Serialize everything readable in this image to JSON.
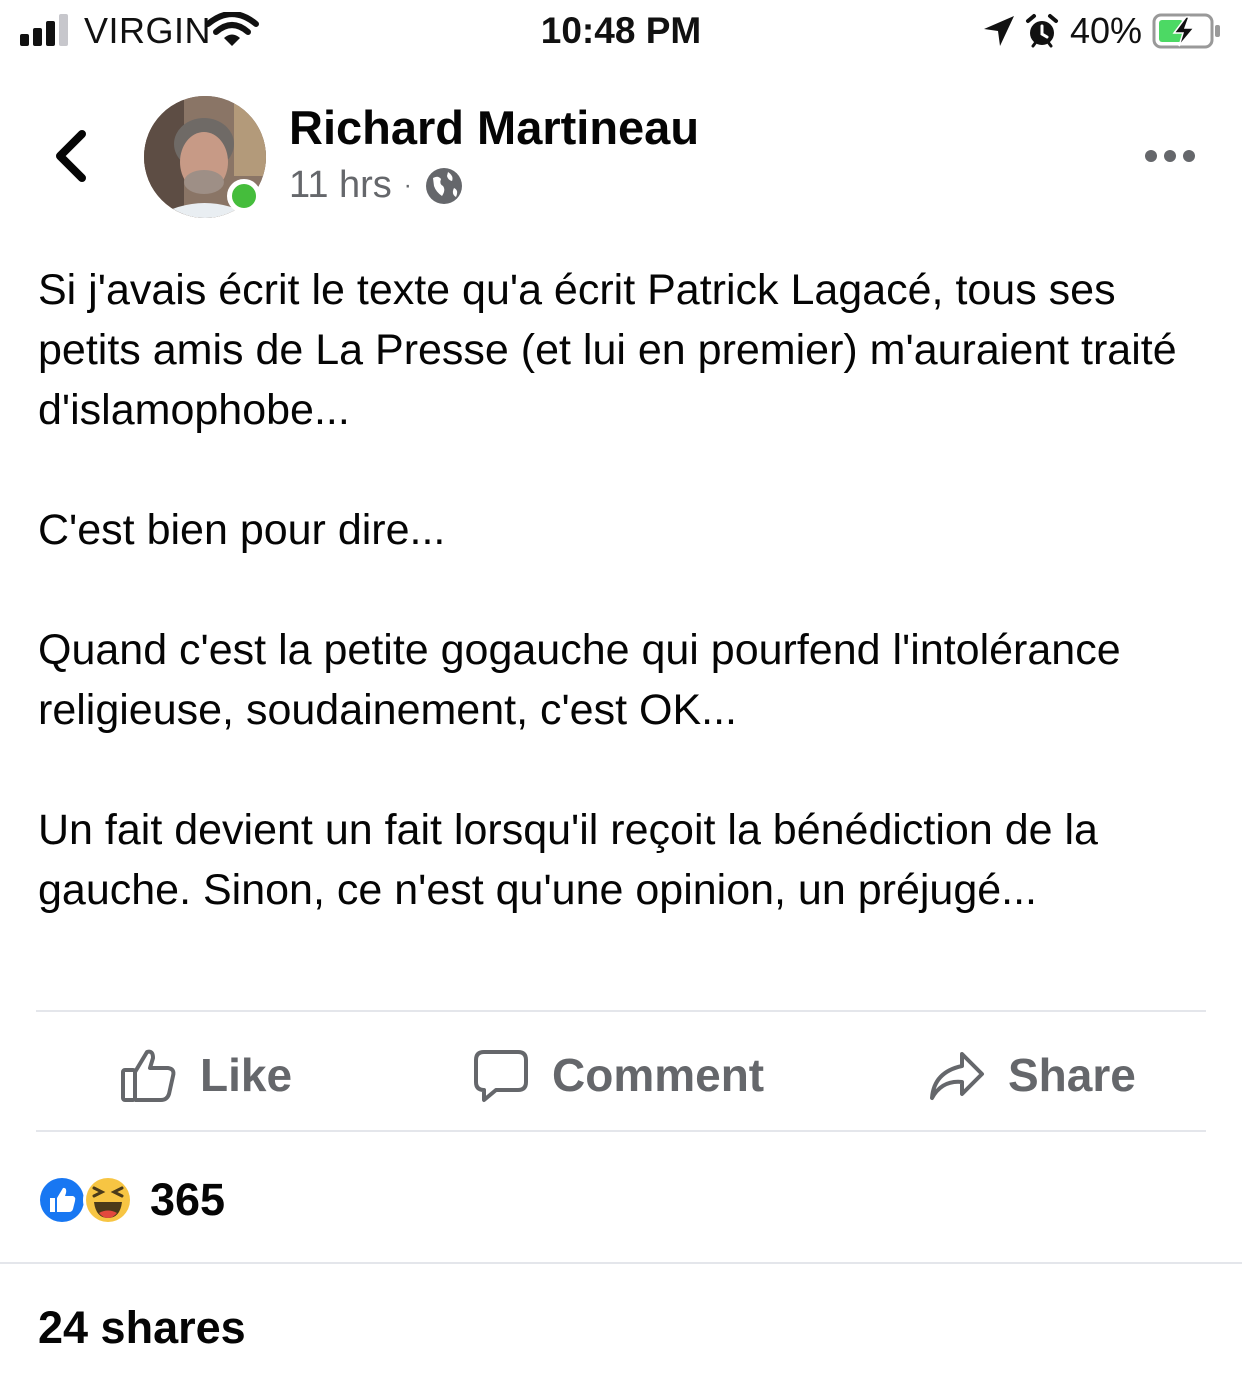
{
  "status_bar": {
    "carrier": "VIRGIN",
    "time": "10:48 PM",
    "battery_percent": "40%",
    "signal_bars_filled": 3,
    "signal_bars_total": 4,
    "icons": [
      "signal-icon",
      "wifi-icon",
      "location-arrow-icon",
      "alarm-icon",
      "battery-charging-icon"
    ]
  },
  "post": {
    "author": "Richard Martineau",
    "time_ago": "11 hrs",
    "separator": "·",
    "audience_icon": "globe-icon",
    "online": true,
    "paragraphs": [
      "Si j'avais écrit le texte qu'a écrit Patrick Lagacé, tous ses petits amis de La Presse (et lui en premier) m'auraient traité d'islamophobe...",
      "C'est bien pour dire...",
      "Quand c'est la petite gogauche qui pourfend l'intolérance religieuse, soudainement, c'est OK...",
      "Un fait devient un fait lorsqu'il reçoit la bénédiction de la gauche. Sinon, ce n'est qu'une opinion, un préjugé..."
    ]
  },
  "actions": {
    "like": "Like",
    "comment": "Comment",
    "share": "Share"
  },
  "engagement": {
    "reaction_icons": [
      "like-reaction-icon",
      "haha-reaction-icon"
    ],
    "reaction_count": "365",
    "shares": "24 shares"
  },
  "colors": {
    "text": "#050505",
    "secondary": "#65676b",
    "online": "#45bd3c",
    "like_blue": "#1877f2",
    "battery_green": "#4cd964"
  }
}
